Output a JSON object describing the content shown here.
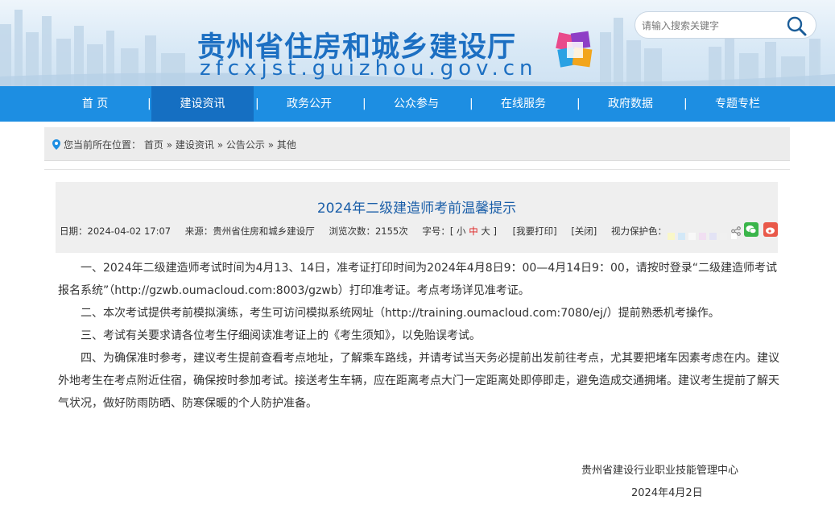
{
  "header": {
    "site_title": "贵州省住房和城乡建设厅",
    "site_domain": "zfcxjst.guizhou.gov.cn",
    "search_placeholder": "请输入搜索关键字"
  },
  "nav": {
    "items": [
      {
        "label": "首  页"
      },
      {
        "label": "建设资讯"
      },
      {
        "label": "政务公开"
      },
      {
        "label": "公众参与"
      },
      {
        "label": "在线服务"
      },
      {
        "label": "政府数据"
      },
      {
        "label": "专题专栏"
      }
    ],
    "separator": "|"
  },
  "breadcrumb": {
    "prefix": "您当前所在位置：",
    "items": [
      "首页",
      "建设资讯",
      "公告公示",
      "其他"
    ],
    "sep": "»"
  },
  "article": {
    "title": "2024年二级建造师考前温馨提示",
    "meta": {
      "date": "日期：2024-04-02 17:07",
      "source": "来源：贵州省住房和城乡建设厅",
      "views": "浏览次数：2155次",
      "font_label": "字号：[",
      "font_small": "小",
      "font_mid": "中",
      "font_large": "大",
      "font_close": "]",
      "print": "[我要打印]",
      "close": "[关闭]",
      "eye_label": "视力保护色："
    },
    "swatches": [
      "#f9f7c8",
      "#d3e8f7",
      "#f8f8f8",
      "#f1dff2",
      "#e3e3f5",
      "#f0f0f0",
      "#ffffff"
    ],
    "paragraphs": [
      "一、2024年二级建造师考试时间为4月13、14日，准考证打印时间为2024年4月8日9：00—4月14日9：00，请按时登录“二级建造师考试报名系统”（http://gzwb.oumacloud.com:8003/gzwb）打印准考证。考点考场详见准考证。",
      "二、本次考试提供考前模拟演练，考生可访问模拟系统网址（http://training.oumacloud.com:7080/ej/）提前熟悉机考操作。",
      "三、考试有关要求请各位考生仔细阅读准考证上的《考生须知》，以免贻误考试。",
      "四、为确保准时参考，建议考生提前查看考点地址，了解乘车路线，并请考试当天务必提前出发前往考点，尤其要把堵车因素考虑在内。建议外地考生在考点附近住宿，确保按时参加考试。接送考生车辆，应在距离考点大门一定距离处即停即走，避免造成交通拥堵。建议考生提前了解天气状况，做好防雨防晒、防寒保暖的个人防护准备。"
    ],
    "signature": "贵州省建设行业职业技能管理中心",
    "sign_date": "2024年4月2日"
  },
  "colors": {
    "nav_bg": "#1d8ee2",
    "nav_active": "#156fc2",
    "title_blue": "#1a5ea8",
    "brand_blue": "#1c6fc2"
  }
}
